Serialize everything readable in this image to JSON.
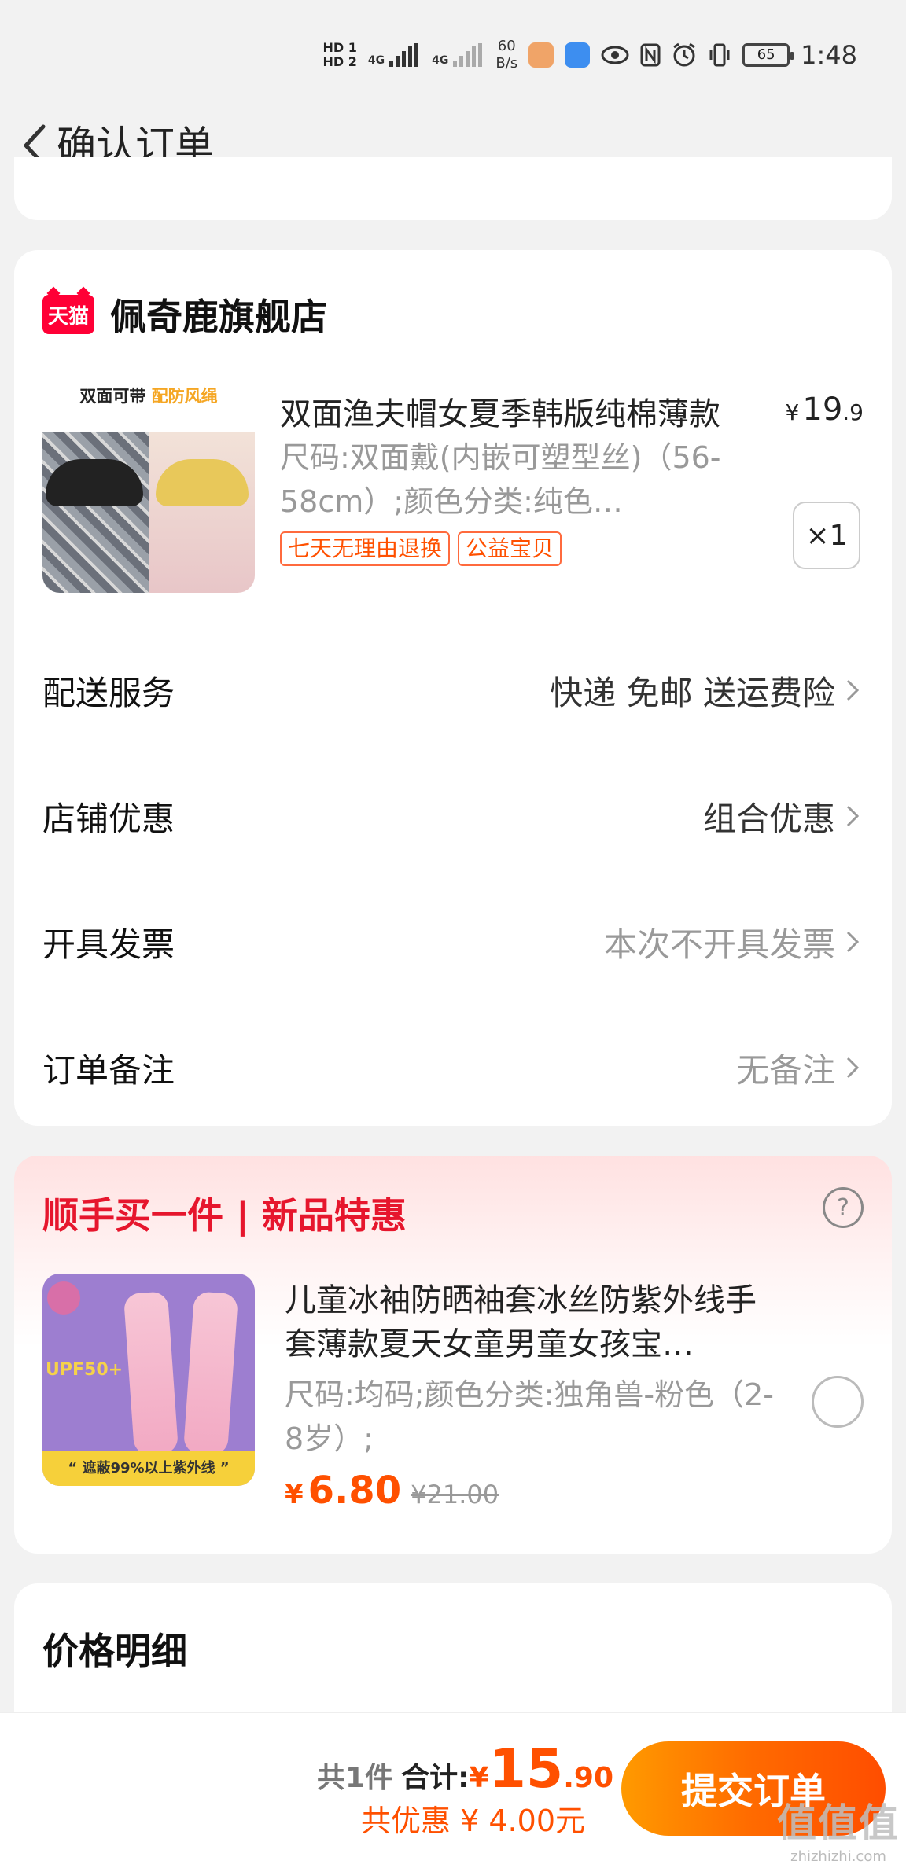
{
  "status_bar": {
    "sim1": "HD 1",
    "sim2": "HD 2",
    "net1": "4G",
    "net2": "4G",
    "speed_value": "60",
    "speed_unit": "B/s",
    "battery": "65",
    "time": "1:48",
    "icons": [
      "message-app-icon",
      "cloud-app-icon",
      "eye-icon",
      "nfc-icon",
      "alarm-icon",
      "vibrate-icon"
    ]
  },
  "header": {
    "title": "确认订单"
  },
  "store": {
    "logo_text": "天猫",
    "name": "佩奇鹿旗舰店"
  },
  "product": {
    "image_banner": "双面可带",
    "image_banner_highlight": "配防风绳",
    "title": "双面渔夫帽女夏季韩版纯棉薄款",
    "price_symbol": "¥",
    "price_int": "19",
    "price_dec": ".9",
    "sku": "尺码:双面戴(内嵌可塑型丝)（56-58cm）;颜色分类:纯色…",
    "tags": [
      "七天无理由退换",
      "公益宝贝"
    ],
    "quantity": "×1"
  },
  "options": [
    {
      "label": "配送服务",
      "value": "快递 免邮 送运费险",
      "muted": false
    },
    {
      "label": "店铺优惠",
      "value": "组合优惠",
      "muted": false
    },
    {
      "label": "开具发票",
      "value": "本次不开具发票",
      "muted": true
    },
    {
      "label": "订单备注",
      "value": "无备注",
      "muted": true
    }
  ],
  "upsell": {
    "title": "顺手买一件 | 新品特惠",
    "help": "?",
    "image_upf": "UPF50+",
    "image_strip": "“ 遮蔽99%以上紫外线 ”",
    "item_title": "儿童冰袖防晒袖套冰丝防紫外线手套薄款夏天女童男童女孩宝…",
    "sku": "尺码:均码;颜色分类:独角兽-粉色（2-8岁）;",
    "price_symbol": "¥",
    "price": "6.80",
    "original_price": "¥21.00"
  },
  "price_detail": {
    "title": "价格明细"
  },
  "bottom_bar": {
    "count": "共1件",
    "total_label": "合计:",
    "total_symbol": "¥",
    "total_int": "15",
    "total_dec": ".90",
    "discount": "共优惠 ¥ 4.00元",
    "submit": "提交订单"
  },
  "watermark": {
    "main": "值值值",
    "sub": "zhizhizhi.com"
  },
  "colors": {
    "accent": "#ff5000",
    "tmall_red": "#ff0036",
    "upsell_title": "#e6162d",
    "button_gradient_start": "#ff9a00",
    "button_gradient_end": "#ff4d00"
  }
}
